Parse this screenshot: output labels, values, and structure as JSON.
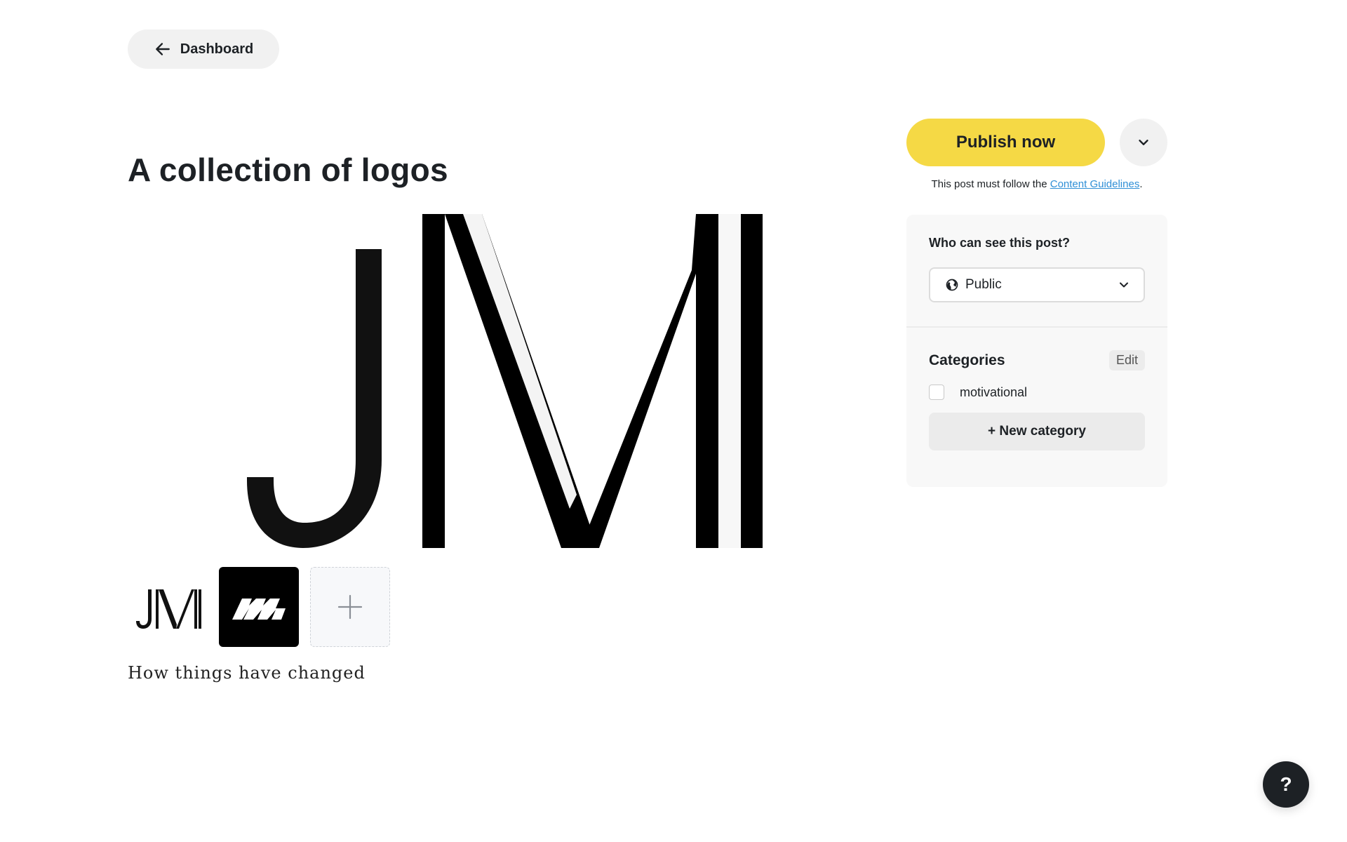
{
  "nav": {
    "back_label": "Dashboard"
  },
  "post": {
    "title": "A collection of logos",
    "caption": "How things have changed"
  },
  "publish": {
    "button_label": "Publish now",
    "note_prefix": "This post must follow the ",
    "note_link": "Content Guidelines",
    "note_suffix": "."
  },
  "visibility": {
    "label": "Who can see this post?",
    "selected": "Public"
  },
  "categories": {
    "title": "Categories",
    "edit_label": "Edit",
    "items": [
      {
        "label": "motivational",
        "checked": false
      }
    ],
    "new_label": "+ New category"
  },
  "help": {
    "label": "?"
  },
  "colors": {
    "publish_yellow": "#f5d945",
    "link_blue": "#2f8fd6",
    "text_dark": "#1d2125"
  },
  "icons": {
    "back": "arrow-left-icon",
    "publish_more": "chevron-down-icon",
    "visibility": "globe-icon",
    "select": "chevron-down-icon",
    "add_image": "plus-icon"
  }
}
